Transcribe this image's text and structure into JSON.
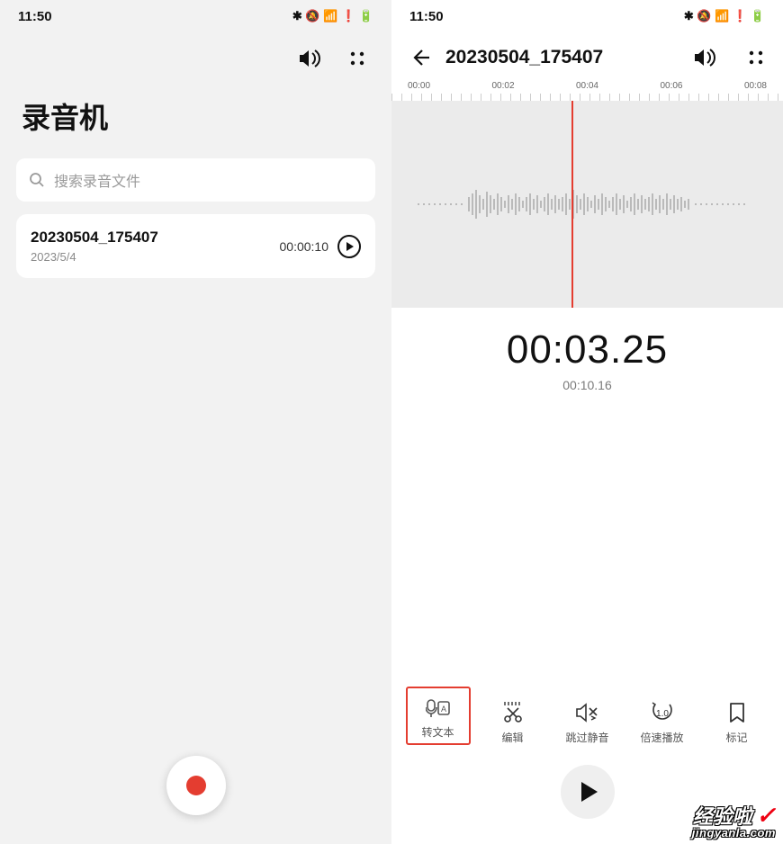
{
  "status_time": "11:50",
  "status_icons_text": "✱ 🔕 📶 ❗ 🔋",
  "left": {
    "title": "录音机",
    "search_placeholder": "搜索录音文件",
    "item": {
      "name": "20230504_175407",
      "date": "2023/5/4",
      "duration": "00:00:10"
    }
  },
  "right": {
    "title": "20230504_175407",
    "ticks": [
      "00:00",
      "00:02",
      "00:04",
      "00:06",
      "00:08"
    ],
    "time_current": "00:03.25",
    "time_total": "00:10.16",
    "tools": {
      "transcribe": "转文本",
      "edit": "编辑",
      "skip_silence": "跳过静音",
      "speed": "倍速播放",
      "bookmark": "标记",
      "speed_value": "1.0"
    }
  },
  "watermark": {
    "line1": "经验啦",
    "line2": "jingyanla.com"
  }
}
